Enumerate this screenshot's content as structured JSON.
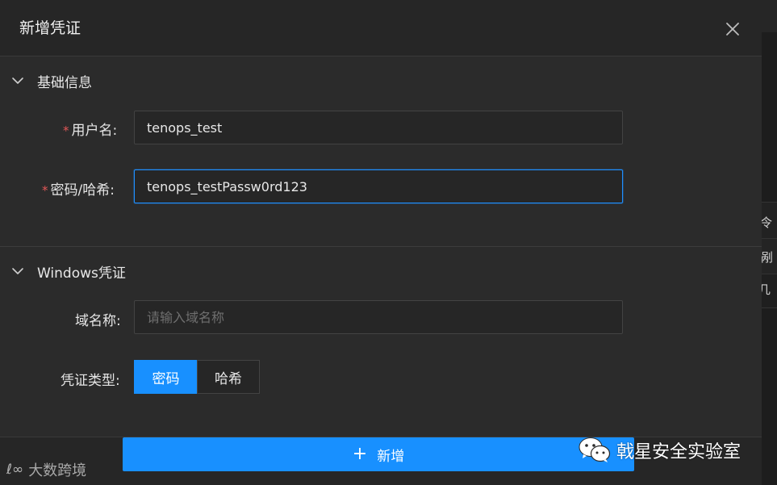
{
  "drawer": {
    "title": "新增凭证"
  },
  "sections": {
    "basic": {
      "label": "基础信息"
    },
    "windows": {
      "label": "Windows凭证"
    }
  },
  "fields": {
    "username": {
      "required_mark": "*",
      "label": "用户名:",
      "value": "tenops_test"
    },
    "password": {
      "required_mark": "*",
      "label": "密码/哈希:",
      "value": "tenops_testPassw0rd123"
    },
    "domain": {
      "label": "域名称:",
      "placeholder": "请输入域名称",
      "value": ""
    },
    "cred_type": {
      "label": "凭证类型:",
      "options": [
        "密码",
        "哈希"
      ],
      "selected": "密码"
    }
  },
  "footer": {
    "add_icon": "plus-icon",
    "add_label": "+ 新增",
    "add_text": "新增"
  },
  "watermarks": {
    "left_logo": "ℓ∞",
    "left_text": "大数跨境",
    "right_text": "戟星安全实验室"
  },
  "background_fragments": [
    "剐",
    "几",
    "令"
  ],
  "colors": {
    "accent": "#1890ff",
    "required": "#e25757",
    "panel": "#2b2b2b",
    "header": "#262626"
  }
}
